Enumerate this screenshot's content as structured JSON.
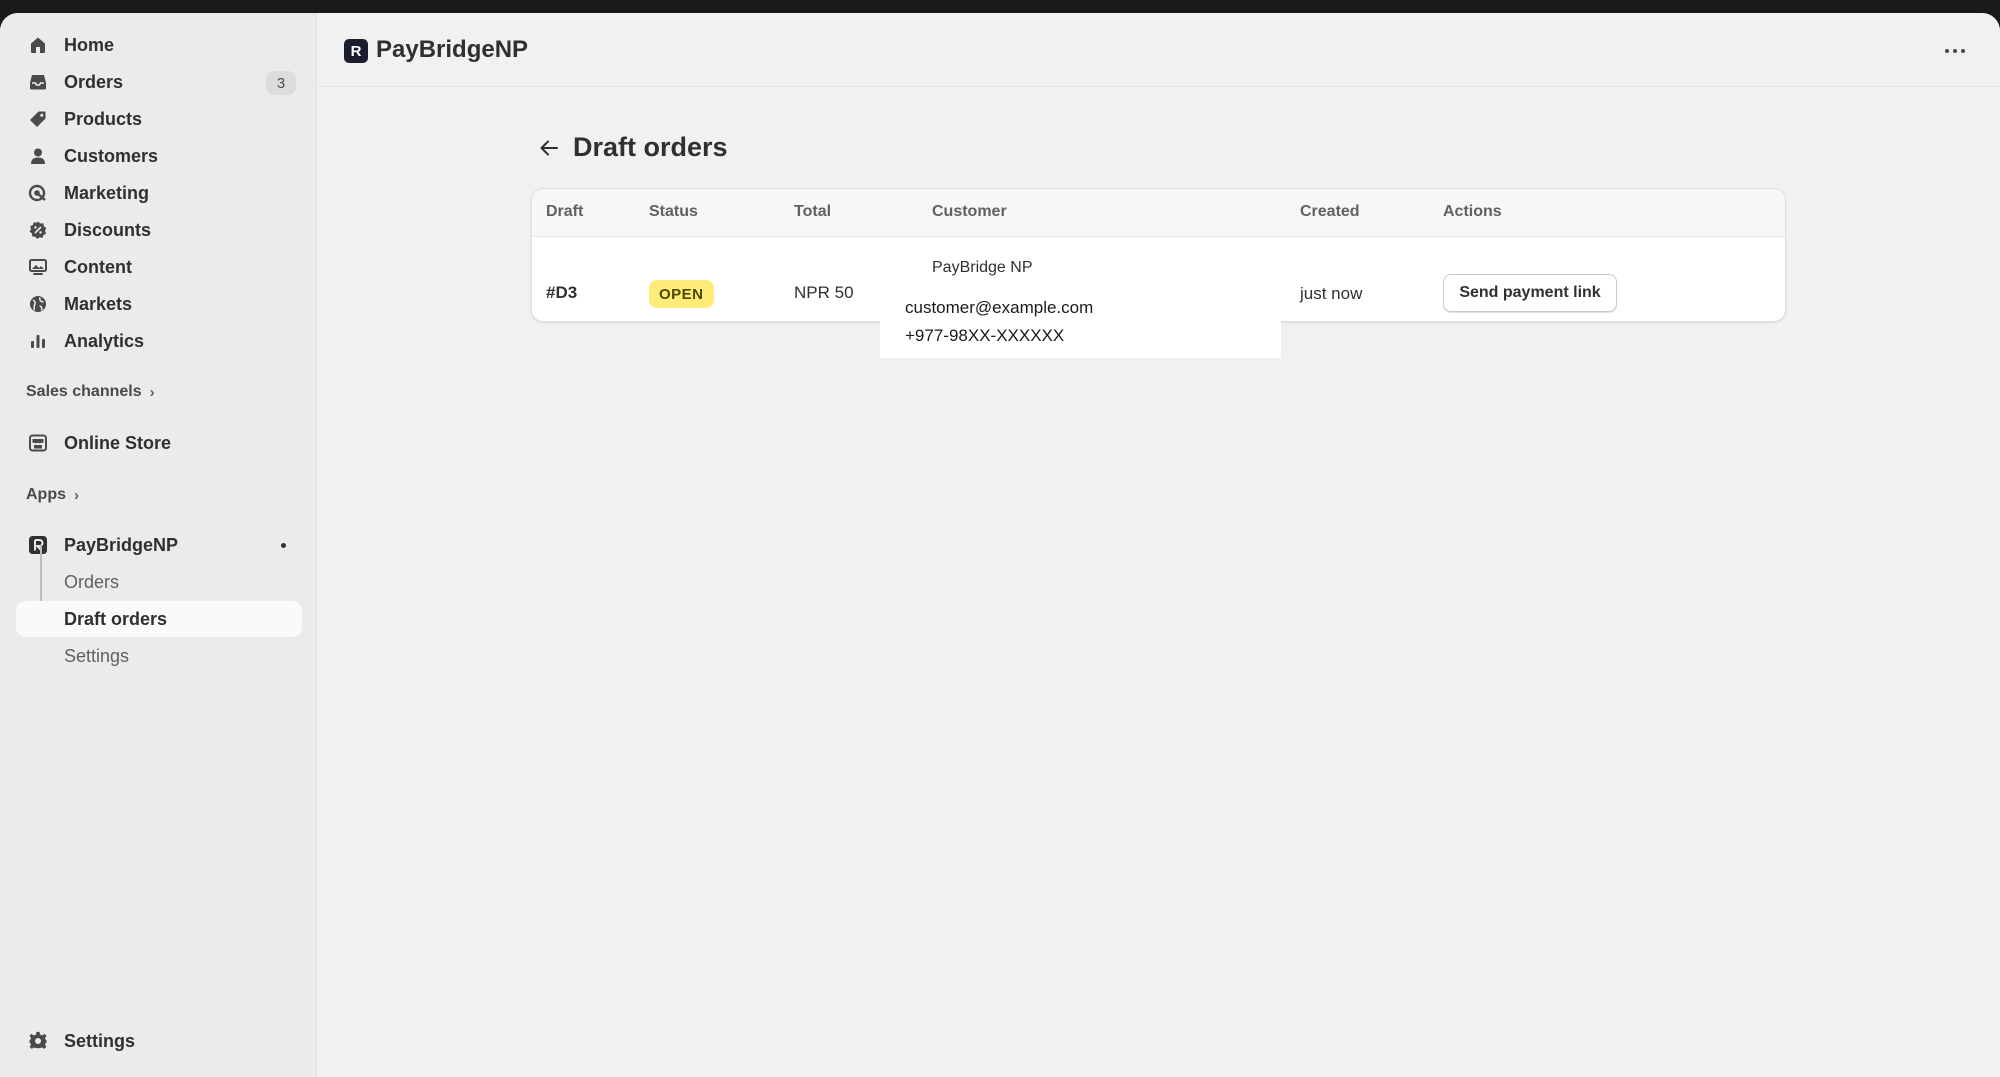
{
  "app": {
    "title": "PayBridgeNP",
    "logo_letter": "R"
  },
  "sidebar": {
    "items": [
      {
        "label": "Home",
        "icon": "home-icon"
      },
      {
        "label": "Orders",
        "icon": "inbox-icon",
        "badge": "3"
      },
      {
        "label": "Products",
        "icon": "tag-icon"
      },
      {
        "label": "Customers",
        "icon": "person-icon"
      },
      {
        "label": "Marketing",
        "icon": "target-icon"
      },
      {
        "label": "Discounts",
        "icon": "discount-icon"
      },
      {
        "label": "Content",
        "icon": "image-icon"
      },
      {
        "label": "Markets",
        "icon": "globe-icon"
      },
      {
        "label": "Analytics",
        "icon": "bar-chart-icon"
      }
    ],
    "sales_channels_label": "Sales channels",
    "online_store_label": "Online Store",
    "apps_label": "Apps",
    "app_item": {
      "label": "PayBridgeNP",
      "sub_items": [
        {
          "label": "Orders"
        },
        {
          "label": "Draft orders",
          "active": true
        },
        {
          "label": "Settings"
        }
      ]
    },
    "settings_label": "Settings"
  },
  "page": {
    "title": "Draft orders"
  },
  "table": {
    "headers": [
      "Draft",
      "Status",
      "Total",
      "Customer",
      "Created",
      "Actions"
    ],
    "rows": [
      {
        "draft": "#D3",
        "status": "OPEN",
        "total": "NPR 50",
        "customer_name": "PayBridge NP",
        "customer_email": "customer@example.com",
        "customer_phone": "+977-98XX-XXXXXX",
        "created": "just now",
        "action": "Send payment link"
      }
    ]
  },
  "colors": {
    "status_open_bg": "#ffeb78",
    "sidebar_bg": "#ebebeb",
    "page_bg": "#f1f1f1"
  }
}
